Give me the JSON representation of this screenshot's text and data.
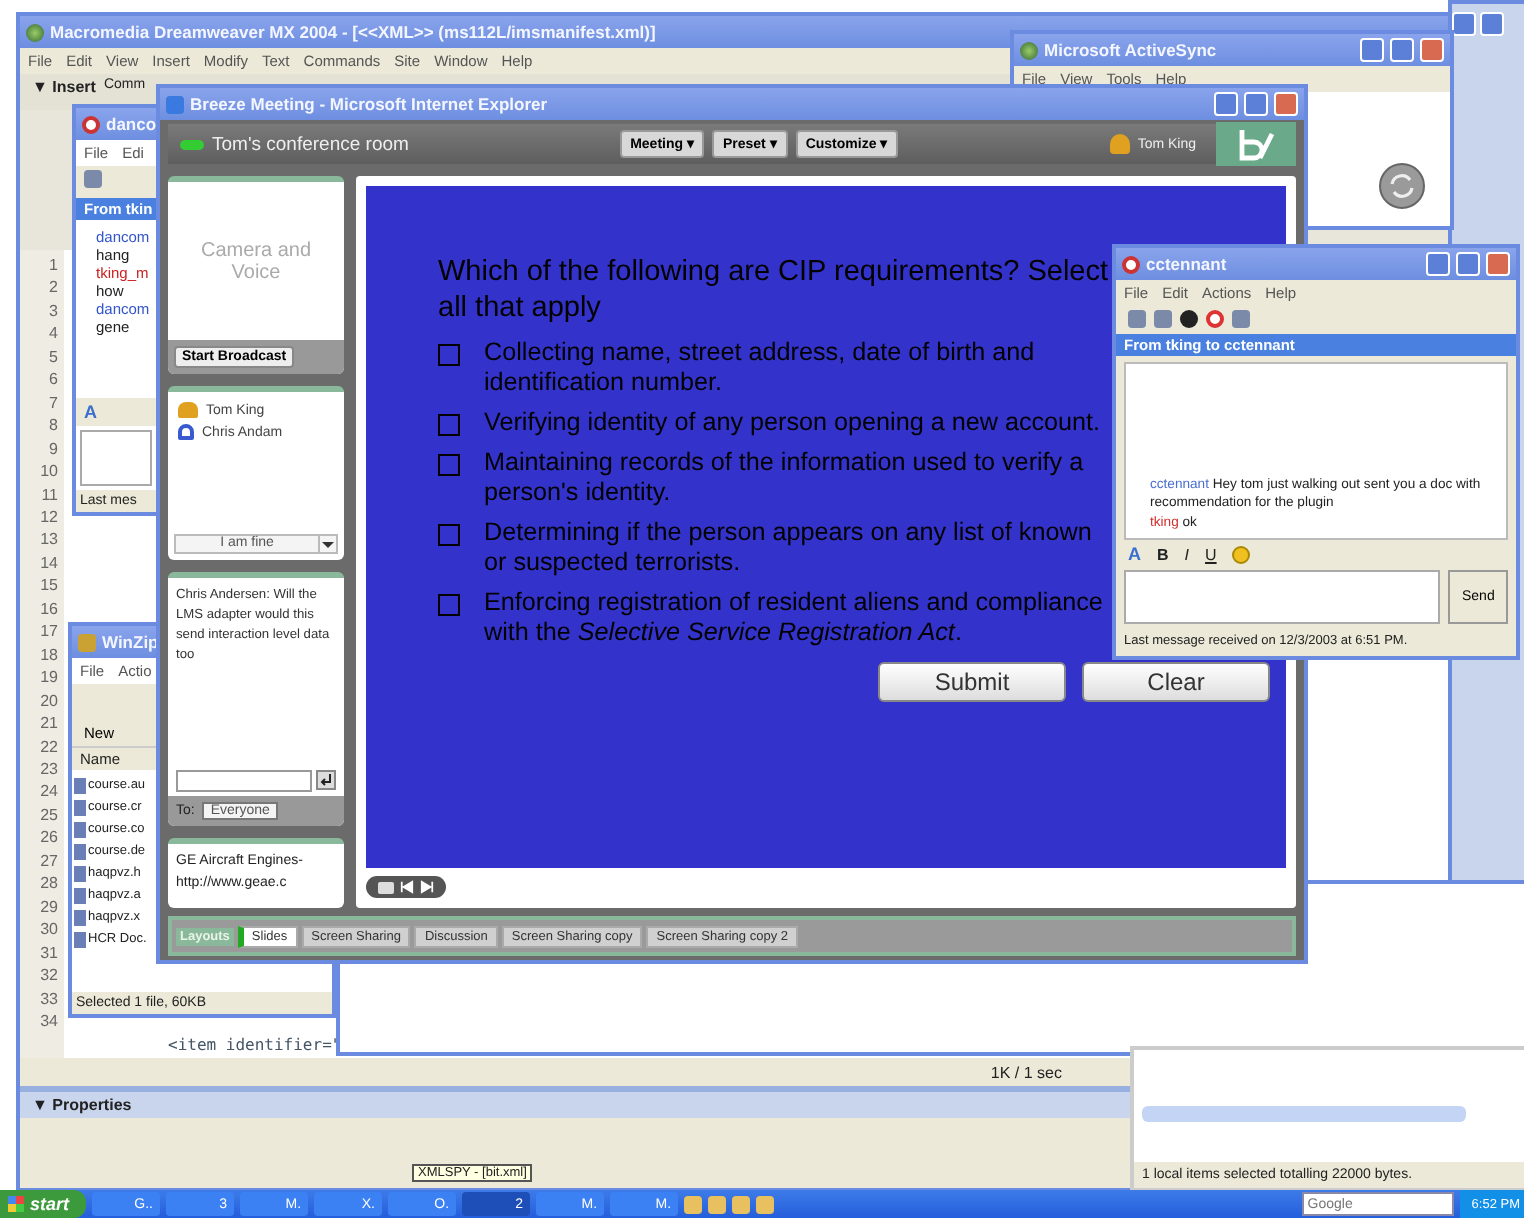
{
  "dreamweaver": {
    "title": "Macromedia Dreamweaver MX 2004 - [<<XML>> (ms112L/imsmanifest.xml)]",
    "menu": [
      "File",
      "Edit",
      "View",
      "Insert",
      "Modify",
      "Text",
      "Commands",
      "Site",
      "Window",
      "Help"
    ],
    "insert_label": "▼ Insert",
    "insert_tab": "Comm",
    "line_numbers": [
      "1",
      "2",
      "3",
      "4",
      "5",
      "6",
      "7",
      "8",
      "9",
      "10",
      "11",
      "12",
      "13",
      "14",
      "15",
      "16",
      "17",
      "18",
      "19",
      "20",
      "21",
      "22",
      "23",
      "24",
      "25",
      "26",
      "27",
      "28",
      "29",
      "30",
      "31",
      "32",
      "33",
      "34"
    ],
    "code_line": "<item identifier=\"",
    "status": "1K / 1 sec",
    "properties": "▼ Properties"
  },
  "activesync": {
    "title": "Microsoft ActiveSync",
    "menu": [
      "File",
      "View",
      "Tools",
      "Help"
    ]
  },
  "im_small": {
    "title": "danco",
    "menu": [
      "File",
      "Edi"
    ],
    "header": "From tkin",
    "format_button": "A",
    "lines": [
      {
        "text": "dancom",
        "color": "#3355cc"
      },
      {
        "text": "hang",
        "color": "#222222"
      },
      {
        "text": "tking_m",
        "color": "#cc2222"
      },
      {
        "text": "how",
        "color": "#222222"
      },
      {
        "text": "dancom",
        "color": "#3355cc"
      },
      {
        "text": "gene",
        "color": "#222222"
      }
    ],
    "status": "Last mes"
  },
  "winzip": {
    "title": "WinZip",
    "menu": [
      "File",
      "Actio"
    ],
    "new_label": "New",
    "column": "Name",
    "files": [
      "course.au",
      "course.cr",
      "course.co",
      "course.de",
      "haqpvz.h",
      "haqpvz.a",
      "haqpvz.x",
      "HCR Doc."
    ],
    "status": "Selected 1 file, 60KB"
  },
  "breeze": {
    "title": "Breeze Meeting - Microsoft Internet Explorer",
    "room": "Tom's conference room",
    "menus": [
      "Meeting ▾",
      "Preset ▾",
      "Customize ▾"
    ],
    "user": "Tom King",
    "camera": {
      "label": "Camera and Voice",
      "button": "Start Broadcast"
    },
    "attendees": [
      {
        "name": "Tom King",
        "kind": "host"
      },
      {
        "name": "Chris Andam",
        "kind": "participant"
      }
    ],
    "status": "I am fine",
    "chat": {
      "text": "Chris Andersen: Will the LMS adapter would this send interaction level data too",
      "to_label": "To:",
      "to_value": "Everyone"
    },
    "links": [
      "GE Aircraft Engines-",
      "http://www.geae.c"
    ],
    "quiz": {
      "question": "Which of the following are CIP requirements? Select all that apply",
      "options": [
        {
          "text": "Collecting  name, street address, date of birth and identification number.",
          "checked": false
        },
        {
          "text": "Verifying identity of any person opening a new account.",
          "checked": false
        },
        {
          "text": "Maintaining records of the information used to verify a person's identity.",
          "checked": false
        },
        {
          "text": "Determining if the person appears on any list of known or suspected terrorists.",
          "checked": false
        },
        {
          "text": "Enforcing registration of resident aliens and compliance with the *Selective Service Registration Act*.",
          "checked": false
        }
      ],
      "buttons": [
        "Submit",
        "Clear"
      ]
    },
    "layouts_label": "Layouts",
    "tabs": [
      {
        "label": "Slides",
        "selected": true
      },
      {
        "label": "Screen Sharing",
        "selected": false
      },
      {
        "label": "Discussion",
        "selected": false
      },
      {
        "label": "Screen Sharing copy",
        "selected": false
      },
      {
        "label": "Screen Sharing copy 2",
        "selected": false
      }
    ]
  },
  "im": {
    "title": "cctennant",
    "menu": [
      "File",
      "Edit",
      "Actions",
      "Help"
    ],
    "header": "From tking to cctennant",
    "messages": [
      {
        "sender": "cctennant",
        "text": "Hey tom just walking out sent you a doc with recommendation for the plugin",
        "color": "#4a6fd0"
      },
      {
        "sender": "tking",
        "text": "ok",
        "color": "#d03030"
      }
    ],
    "format_buttons": [
      "A",
      "B",
      "I",
      "U"
    ],
    "send": "Send",
    "status": "Last message received on 12/3/2003 at 6:51 PM."
  },
  "explorer_pane": {
    "status": "1 local items selected totalling 22000 bytes."
  },
  "tooltip": "XMLSPY - [bit.xml]",
  "taskbar": {
    "start": "start",
    "buttons": [
      {
        "label": "G..",
        "selected": false
      },
      {
        "label": "3",
        "selected": false
      },
      {
        "label": "M.",
        "selected": false
      },
      {
        "label": "X.",
        "selected": false
      },
      {
        "label": "O.",
        "selected": false
      },
      {
        "label": "2",
        "selected": true
      },
      {
        "label": "M.",
        "selected": false
      },
      {
        "label": "M.",
        "selected": false
      }
    ],
    "search_placeholder": "Google",
    "clock": "6:52 PM"
  }
}
